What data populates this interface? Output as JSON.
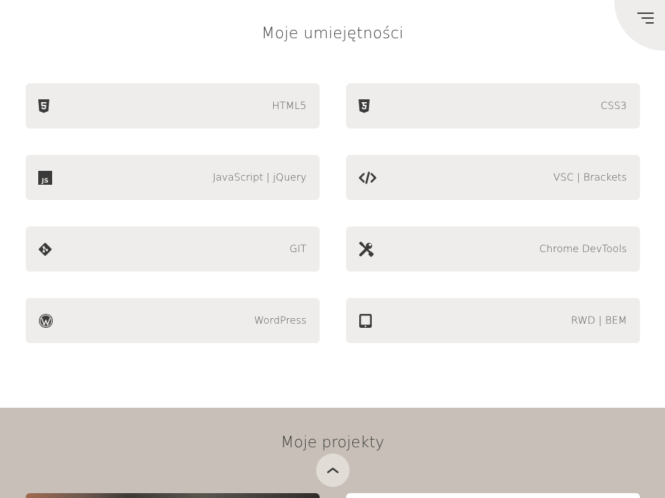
{
  "header": {
    "menu_icon": "hamburger-menu-icon"
  },
  "skills": {
    "title": "Moje umiejętności",
    "items": [
      {
        "label": "HTML5",
        "icon": "html5-icon"
      },
      {
        "label": "CSS3",
        "icon": "css3-icon"
      },
      {
        "label": "JavaScript | jQuery",
        "icon": "js-icon"
      },
      {
        "label": "VSC | Brackets",
        "icon": "code-icon"
      },
      {
        "label": "GIT",
        "icon": "git-icon"
      },
      {
        "label": "Chrome DevTools",
        "icon": "tools-icon"
      },
      {
        "label": "WordPress",
        "icon": "wordpress-icon"
      },
      {
        "label": "RWD | BEM",
        "icon": "tablet-icon"
      }
    ]
  },
  "projects": {
    "title": "Moje projekty",
    "scroll_top_icon": "chevron-up-icon"
  },
  "colors": {
    "card_bg": "#efedeb",
    "projects_bg": "#c8c0b8",
    "text": "#3a3a3a"
  }
}
